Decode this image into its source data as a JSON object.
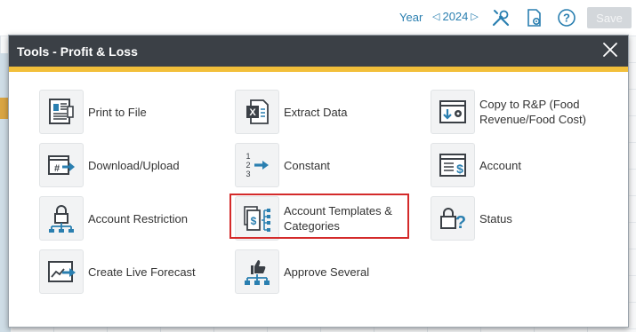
{
  "toolbar": {
    "year_label": "Year",
    "year_value": "2024",
    "prev_arrow": "◁",
    "next_arrow": "▷",
    "save_label": "Save",
    "icons": [
      "tools-icon",
      "settings-page-icon",
      "help-icon"
    ]
  },
  "modal": {
    "title": "Tools - Profit & Loss",
    "close_symbol": "✕",
    "accent_color": "#f2bf3a",
    "highlight_color": "#d42a2a"
  },
  "tools": {
    "print_to_file": {
      "label": "Print to File",
      "icon": "print-to-file-icon"
    },
    "extract_data": {
      "label": "Extract Data",
      "icon": "excel-icon"
    },
    "copy_rp": {
      "label_line1": "Copy to R&P (Food",
      "label_line2": "Revenue/Food Cost)",
      "icon": "copy-settings-icon"
    },
    "download_upload": {
      "label": "Download/Upload",
      "icon": "hash-arrow-icon"
    },
    "constant": {
      "label": "Constant",
      "icon": "constant-icon",
      "digits": [
        "1",
        "2",
        "3"
      ]
    },
    "account": {
      "label": "Account",
      "icon": "account-dollar-icon",
      "symbol": "$"
    },
    "account_restriction": {
      "label": "Account Restriction",
      "icon": "lock-tree-icon"
    },
    "account_templates": {
      "label_line1": "Account Templates &",
      "label_line2": "Categories",
      "icon": "templates-icon",
      "symbol": "$"
    },
    "status": {
      "label": "Status",
      "icon": "lock-question-icon",
      "symbol": "?"
    },
    "create_live_forecast": {
      "label": "Create Live Forecast",
      "icon": "forecast-chart-icon"
    },
    "approve_several": {
      "label": "Approve Several",
      "icon": "thumbs-up-tree-icon"
    }
  }
}
